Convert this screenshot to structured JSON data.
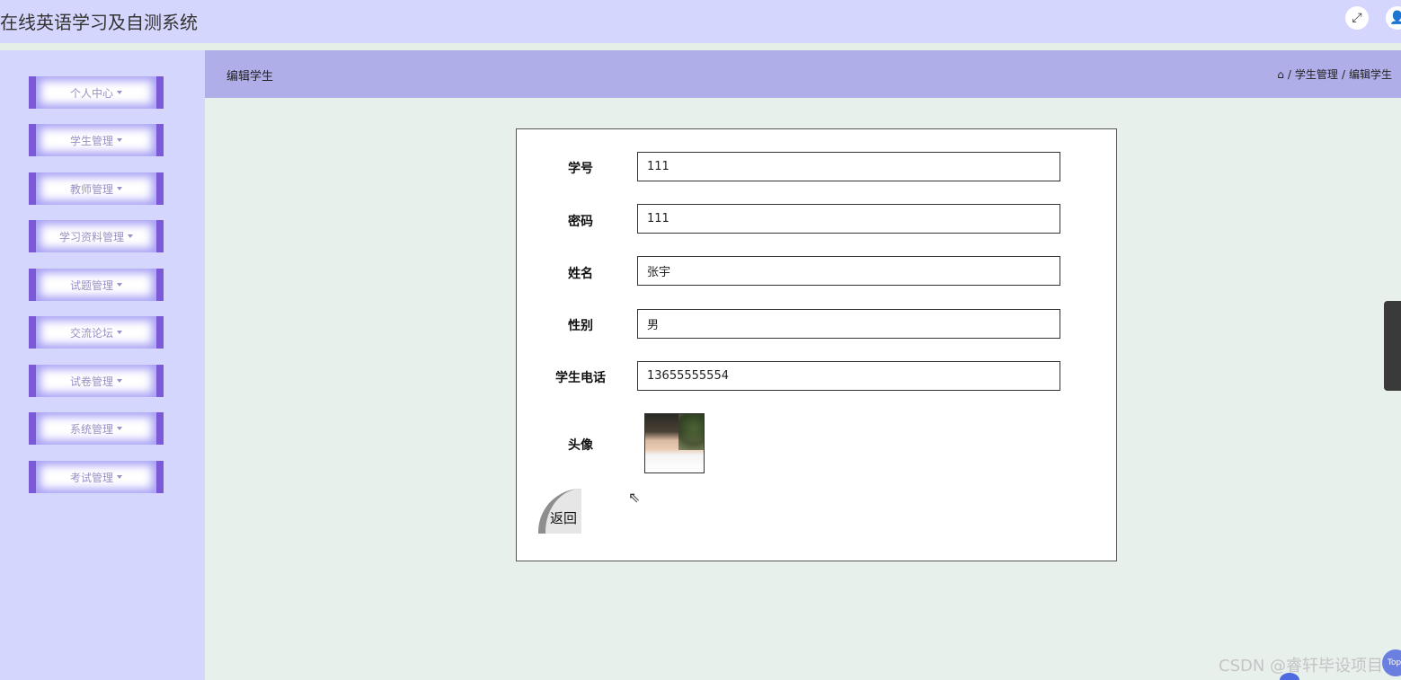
{
  "app": {
    "title": "在线英语学习及自测系统"
  },
  "topbar": {
    "fullscreen_icon": "expand-icon",
    "user_icon": "user-icon"
  },
  "sidebar": {
    "items": [
      {
        "label": "个人中心"
      },
      {
        "label": "学生管理"
      },
      {
        "label": "教师管理"
      },
      {
        "label": "学习资料管理"
      },
      {
        "label": "试题管理"
      },
      {
        "label": "交流论坛"
      },
      {
        "label": "试卷管理"
      },
      {
        "label": "系统管理"
      },
      {
        "label": "考试管理"
      }
    ]
  },
  "header": {
    "page_title": "编辑学生",
    "breadcrumb": [
      "学生管理",
      "编辑学生"
    ],
    "separator": "/"
  },
  "form": {
    "fields": [
      {
        "label": "学号",
        "value": "111"
      },
      {
        "label": "密码",
        "value": "111"
      },
      {
        "label": "姓名",
        "value": "张宇"
      },
      {
        "label": "性别",
        "value": "男"
      },
      {
        "label": "学生电话",
        "value": "13655555554"
      }
    ],
    "avatar_label": "头像",
    "back_label": "返回"
  },
  "watermark": "CSDN @睿轩毕设项目",
  "top_button_label": "Top",
  "colors": {
    "topbar": "#d5d6fd",
    "sidebar": "#d5d6fd",
    "header_band": "#afaee8",
    "content_bg": "#e8f0ec",
    "menu_border": "#7c5ad7",
    "menu_text": "#9a8fc6"
  }
}
